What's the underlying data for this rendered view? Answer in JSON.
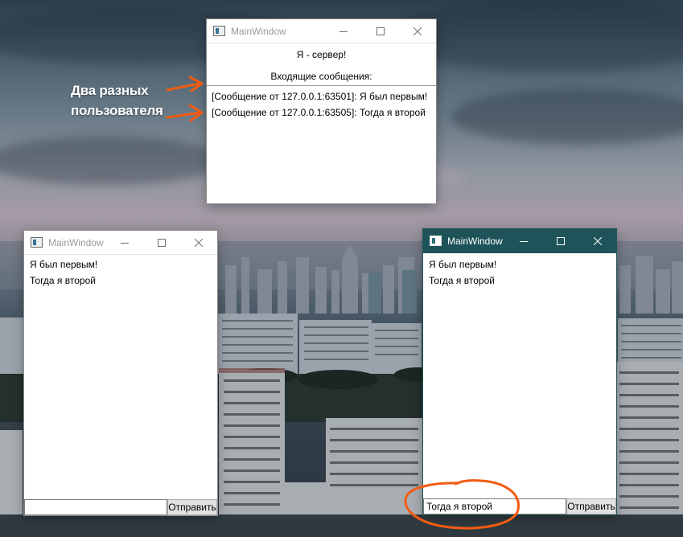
{
  "annotation": {
    "line1": "Два разных",
    "line2": "пользователя",
    "color": "#f25c12"
  },
  "server_window": {
    "title": "MainWindow",
    "heading": "Я - сервер!",
    "subheading": "Входящие сообщения:",
    "messages": [
      "[Сообщение от 127.0.0.1:63501]: Я был первым!",
      "[Сообщение от 127.0.0.1:63505]: Тогда я второй"
    ]
  },
  "client_window_1": {
    "title": "MainWindow",
    "messages": [
      "Я был первым!",
      "Тогда я второй"
    ],
    "input_value": "",
    "send_label": "Отправить"
  },
  "client_window_2": {
    "title": "MainWindow",
    "active": true,
    "titlebar_color": "#1e5459",
    "messages": [
      "Я был первым!",
      "Тогда я второй"
    ],
    "input_value": "Тогда я второй",
    "send_label": "Отправить"
  },
  "icons": {
    "app": "window-app-icon",
    "minimize": "minimize-icon",
    "maximize": "maximize-icon",
    "close": "close-icon"
  }
}
